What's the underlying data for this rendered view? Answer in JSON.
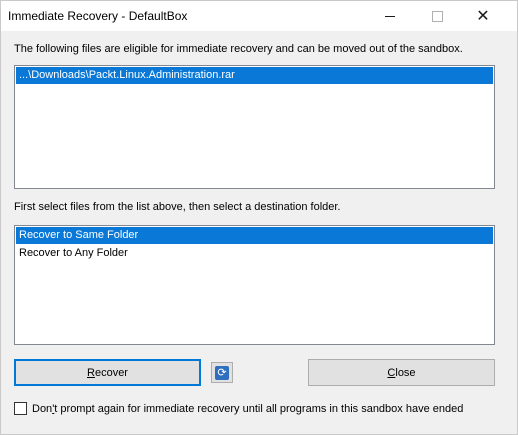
{
  "window": {
    "title": "Immediate Recovery - DefaultBox",
    "minimize_glyph": "",
    "close_glyph": "✕"
  },
  "labels": {
    "eligible": "The following files are eligible for immediate recovery and can be moved out of the sandbox.",
    "select_hint": "First select files from the list above, then select a destination folder."
  },
  "files": [
    {
      "name": "...\\Downloads\\Packt.Linux.Administration.rar",
      "selected": true
    }
  ],
  "destinations": [
    {
      "label": "Recover to Same Folder",
      "selected": true
    },
    {
      "label": "Recover to Any Folder",
      "selected": false
    }
  ],
  "buttons": {
    "recover_first": "R",
    "recover_rest": "ecover",
    "close_first": "C",
    "close_rest": "lose",
    "refresh_icon": "refresh-icon"
  },
  "options": {
    "dont_prompt_pre": "Don",
    "dont_prompt_ul": "'",
    "dont_prompt_rest": "t prompt again for immediate recovery until all programs in this sandbox have ended",
    "dont_prompt_checked": false
  },
  "colors": {
    "selection": "#0a78d7",
    "default_button_border": "#0078d7"
  }
}
